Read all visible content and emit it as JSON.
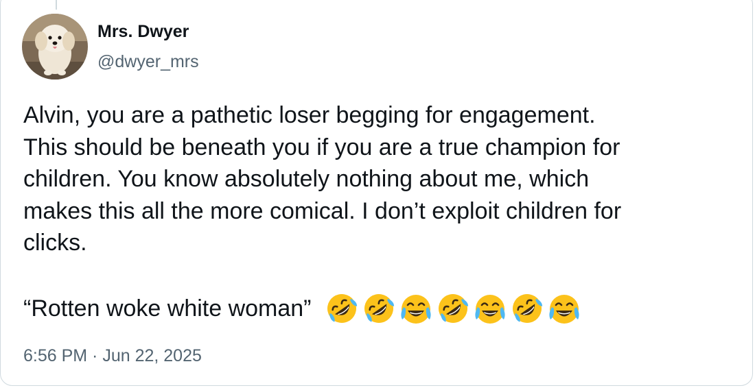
{
  "user": {
    "display_name": "Mrs. Dwyer",
    "handle": "@dwyer_mrs"
  },
  "tweet": {
    "lines": [
      "Alvin, you are a pathetic loser begging for engagement.",
      "This should be beneath you if you are a true champion for",
      "children. You know absolutely nothing about me, which",
      "makes this all the more comical. I don’t exploit children for",
      "clicks."
    ],
    "quote": "“Rotten woke white woman”",
    "emojis": [
      "rolling-on-floor-laughing",
      "rolling-on-floor-laughing",
      "tears-of-joy",
      "rolling-on-floor-laughing",
      "tears-of-joy",
      "rolling-on-floor-laughing",
      "tears-of-joy"
    ],
    "timestamp": "6:56 PM · Jun 22, 2025"
  },
  "colors": {
    "text": "#0f1419",
    "secondary": "#536471",
    "border": "#cfd9de",
    "emoji_face": "#fcc21b",
    "emoji_tears": "#4fb8f2"
  }
}
